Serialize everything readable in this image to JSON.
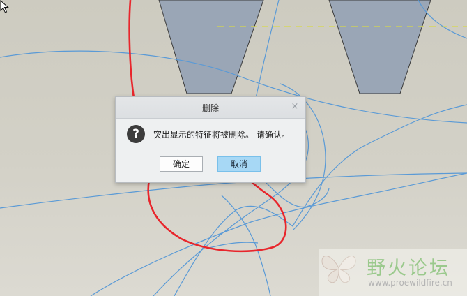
{
  "dialog": {
    "title": "删除",
    "close_icon": "×",
    "message_icon": "?",
    "message": "突出显示的特征将被删除。 请确认。",
    "ok_label": "确定",
    "cancel_label": "取消"
  },
  "watermark": {
    "title": "野火论坛",
    "url": "www.proewildfire.cn"
  },
  "colors": {
    "model_face": "#9aa6b6",
    "highlight_curve": "#e8262c",
    "curve_lines": "#5a9ad6",
    "dash_line": "#d8d84a",
    "cancel_button": "#a7d8f5"
  }
}
